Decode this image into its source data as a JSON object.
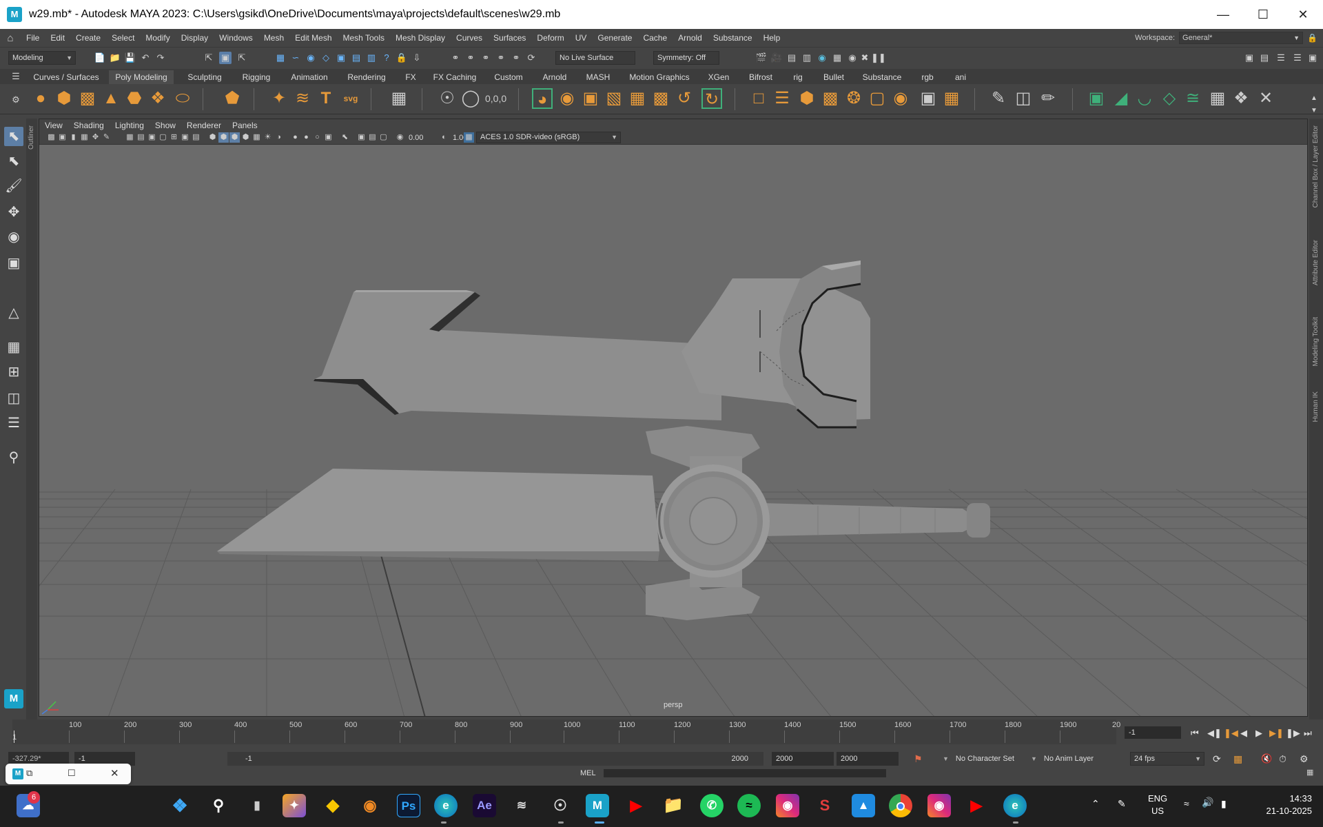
{
  "window": {
    "title": "w29.mb* - Autodesk MAYA 2023: C:\\Users\\gsikd\\OneDrive\\Documents\\maya\\projects\\default\\scenes\\w29.mb",
    "app_icon": "M",
    "controls": [
      "minimize-icon",
      "maximize-icon",
      "close-icon"
    ]
  },
  "menubar": {
    "items": [
      "File",
      "Edit",
      "Create",
      "Select",
      "Modify",
      "Display",
      "Windows",
      "Mesh",
      "Edit Mesh",
      "Mesh Tools",
      "Mesh Display",
      "Curves",
      "Surfaces",
      "Deform",
      "UV",
      "Generate",
      "Cache",
      "Arnold",
      "Substance",
      "Help"
    ],
    "workspace_label": "Workspace:",
    "workspace_value": "General*"
  },
  "statusline": {
    "mode": "Modeling",
    "live_surface": "No Live Surface",
    "symmetry": "Symmetry: Off"
  },
  "shelf": {
    "tabs": [
      "Curves / Surfaces",
      "Poly Modeling",
      "Sculpting",
      "Rigging",
      "Animation",
      "Rendering",
      "FX",
      "FX Caching",
      "Custom",
      "Arnold",
      "MASH",
      "Motion Graphics",
      "XGen",
      "Bifrost",
      "rig",
      "Bullet",
      "Substance",
      "rgb",
      "ani"
    ],
    "active_tab": "Poly Modeling",
    "icon_labels": {
      "text_tool": "T",
      "svg_tool": "svg",
      "coords": "0,0,0"
    }
  },
  "viewport": {
    "menu": [
      "View",
      "Shading",
      "Lighting",
      "Show",
      "Renderer",
      "Panels"
    ],
    "exposure": "0.00",
    "gamma": "1.00",
    "color_space": "ACES 1.0 SDR-video (sRGB)",
    "camera": "persp",
    "side_labels": {
      "left": "Outliner",
      "right": [
        "Channel Box / Layer Editor",
        "Attribute Editor",
        "Modeling Toolkit",
        "Human IK"
      ]
    }
  },
  "timeline": {
    "ticks": [
      "1",
      "100",
      "200",
      "300",
      "400",
      "500",
      "600",
      "700",
      "800",
      "900",
      "1000",
      "1100",
      "1200",
      "1300",
      "1400",
      "1500",
      "1600",
      "1700",
      "1800",
      "1900",
      "20"
    ],
    "current_frame": "-1"
  },
  "rangebar": {
    "coord": "-327.29*",
    "start": "-1",
    "slider_start": "-1",
    "slider_end": "2000",
    "end1": "2000",
    "end2": "2000",
    "character_set": "No Character Set",
    "anim_layer": "No Anim Layer",
    "fps": "24 fps"
  },
  "mel": {
    "label": "MEL"
  },
  "taskbar": {
    "notification_count": "6",
    "apps": [
      "windows-icon",
      "search-icon",
      "file-explorer-blank-icon",
      "copilot-icon",
      "sketch-icon",
      "blender-icon",
      "photoshop-icon",
      "edge-icon",
      "after-effects-icon",
      "terminal-icon",
      "obs-icon",
      "maya-icon",
      "youtube-icon",
      "folder-icon",
      "whatsapp-icon",
      "spotify-icon",
      "instagram-icon",
      "sheets-s-icon",
      "store-icon",
      "chrome-icon",
      "instagram-icon-2",
      "youtube-music-icon",
      "edge-dev-icon"
    ],
    "app_text": {
      "ps": "Ps",
      "ae": "Ae",
      "maya": "M"
    },
    "lang_1": "ENG",
    "lang_2": "US",
    "time": "14:33",
    "date": "21-10-2025"
  },
  "colors": {
    "maya_blue": "#1aa2c8",
    "shelf_orange": "#e79a3a",
    "shelf_green": "#3fb07a",
    "viewport_bg": "#6b6b6b",
    "active_tool": "#5d7fa6"
  }
}
